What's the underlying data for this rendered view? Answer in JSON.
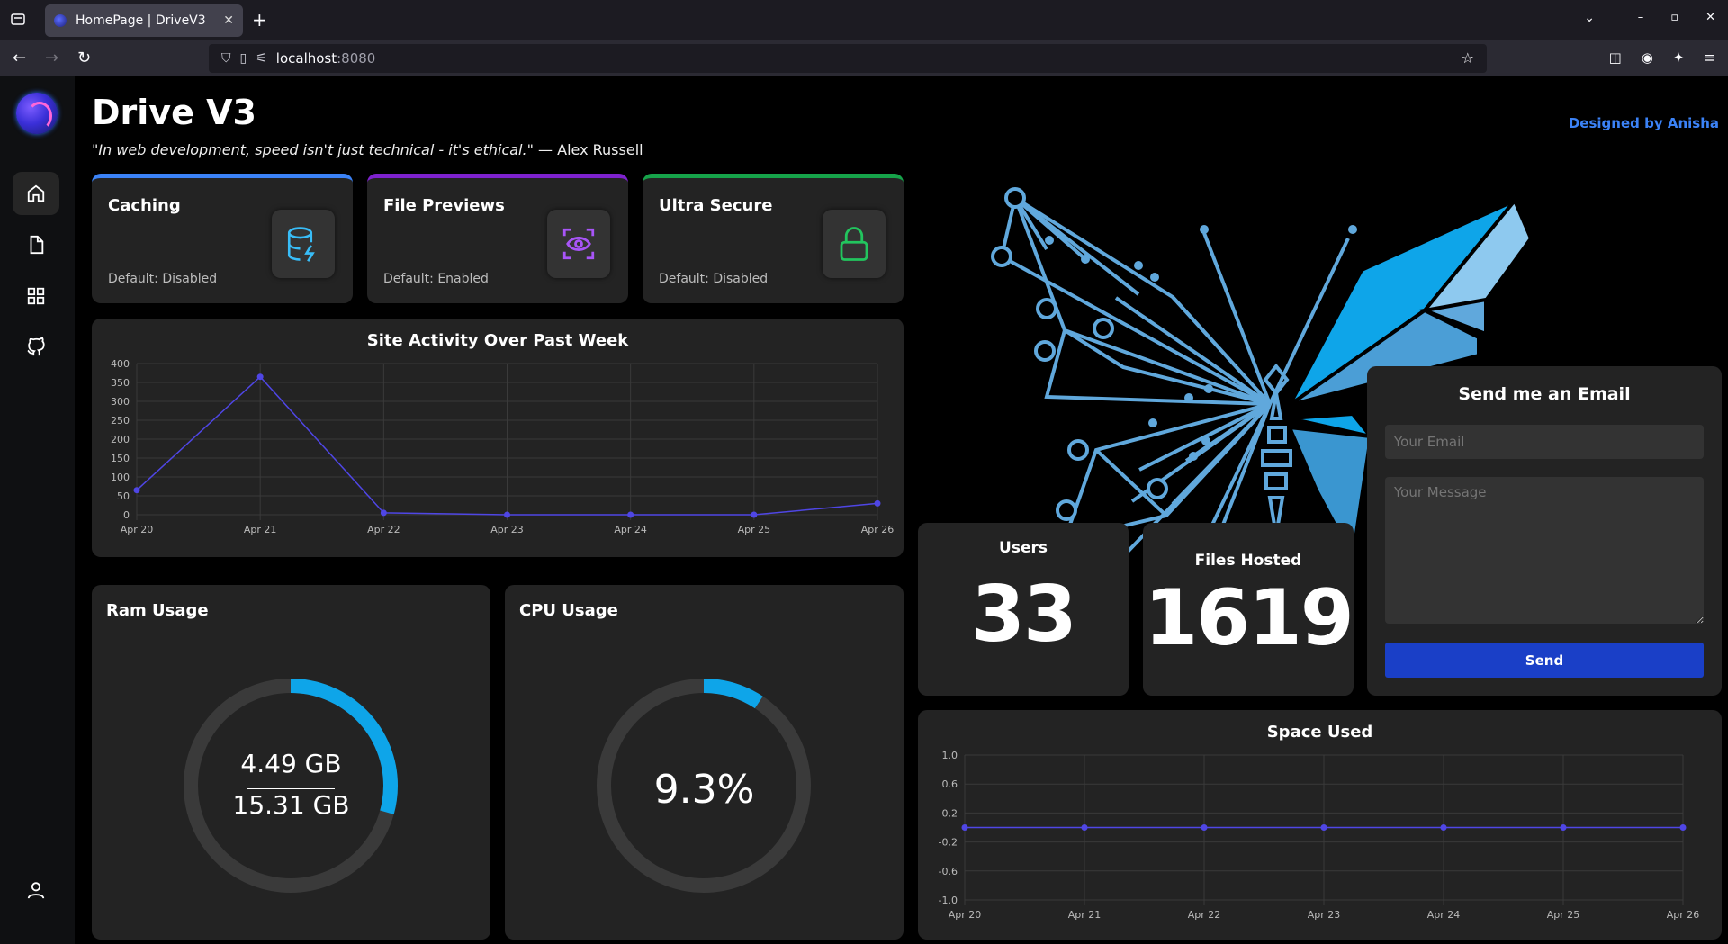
{
  "browser": {
    "tab_title": "HomePage | DriveV3",
    "url_host": "localhost",
    "url_port": ":8080"
  },
  "page": {
    "title": "Drive V3",
    "quote_text": "\"In web development, speed isn't just technical - it's ethical.\"",
    "quote_author": " — Alex Russell",
    "designed_by": "Designed by Anisha"
  },
  "features": [
    {
      "name": "Caching",
      "default": "Default: Disabled",
      "color": "#3b82f6",
      "icon": "database-bolt-icon"
    },
    {
      "name": "File Previews",
      "default": "Default: Enabled",
      "color": "#7e22ce",
      "icon": "eye-scan-icon"
    },
    {
      "name": "Ultra Secure",
      "default": "Default: Disabled",
      "color": "#16a34a",
      "icon": "lock-icon"
    }
  ],
  "activity_chart": {
    "title": "Site Activity Over Past Week"
  },
  "ram": {
    "title": "Ram Usage",
    "used": "4.49 GB",
    "total": "15.31 GB",
    "fraction": 0.293
  },
  "cpu": {
    "title": "CPU Usage",
    "value": "9.3%",
    "fraction": 0.093
  },
  "users": {
    "title": "Users",
    "value": "33"
  },
  "files": {
    "title": "Files Hosted",
    "value": "1619"
  },
  "email": {
    "title": "Send me an Email",
    "email_placeholder": "Your Email",
    "message_placeholder": "Your Message",
    "send_label": "Send"
  },
  "space_chart": {
    "title": "Space Used"
  },
  "colors": {
    "accent": "#0ea5e9",
    "line": "#4f46e5",
    "card": "#232323"
  },
  "chart_data": [
    {
      "type": "line",
      "title": "Site Activity Over Past Week",
      "x": [
        "Apr 20",
        "Apr 21",
        "Apr 22",
        "Apr 23",
        "Apr 24",
        "Apr 25",
        "Apr 26"
      ],
      "values": [
        65,
        365,
        5,
        0,
        0,
        0,
        30
      ],
      "ylim": [
        0,
        400
      ],
      "yticks": [
        "400",
        "350",
        "300",
        "250",
        "200",
        "150",
        "100",
        "50",
        "0"
      ],
      "grid": true
    },
    {
      "type": "line",
      "title": "Space Used",
      "x": [
        "Apr 20",
        "Apr 21",
        "Apr 22",
        "Apr 23",
        "Apr 24",
        "Apr 25",
        "Apr 26"
      ],
      "values": [
        0,
        0,
        0,
        0,
        0,
        0,
        0
      ],
      "ylim": [
        -1,
        1
      ],
      "yticks": [
        "1.0",
        "0.6",
        "0.2",
        "-0.2",
        "-0.6",
        "-1.0"
      ],
      "grid": true
    }
  ]
}
